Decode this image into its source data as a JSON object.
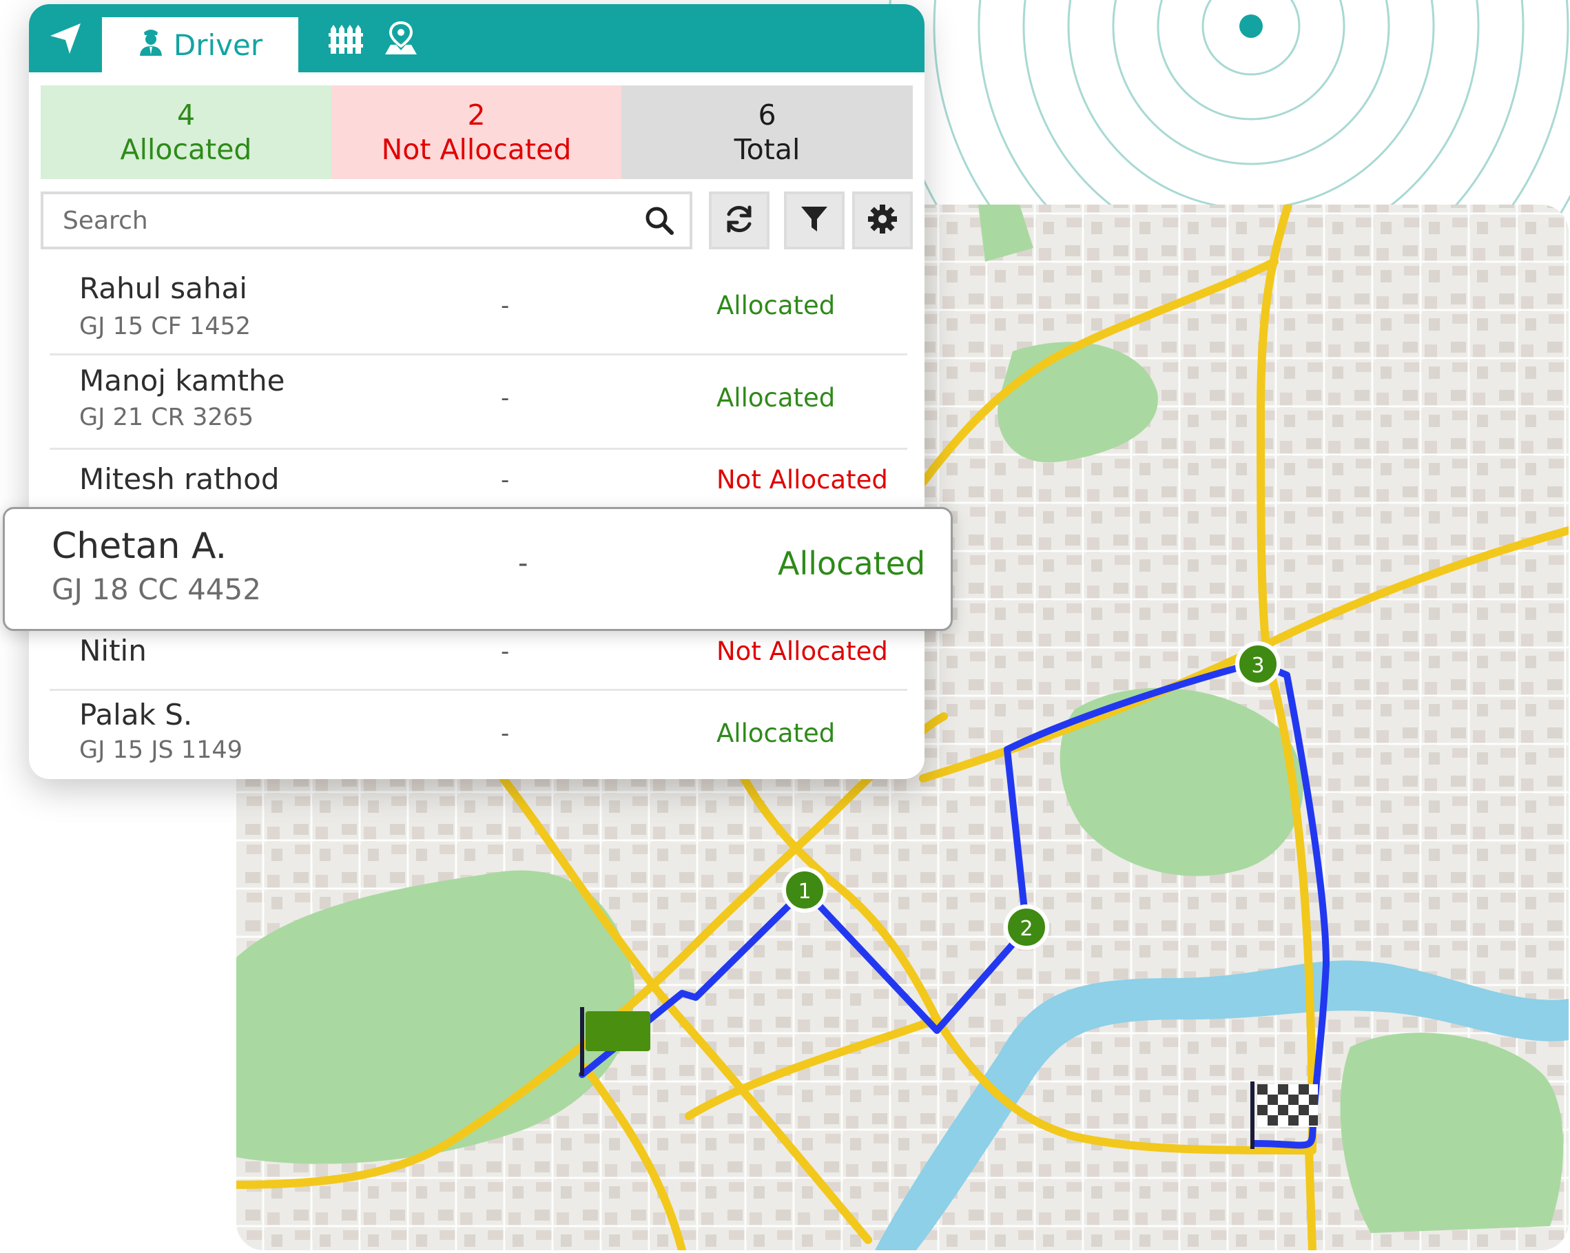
{
  "tabs": {
    "navigate_icon": "navigation-arrow-icon",
    "driver_label": "Driver",
    "driver_icon": "driver-icon",
    "geofence_icon": "fence-icon",
    "zone_icon": "map-pin-icon"
  },
  "summary": {
    "allocated_count": "4",
    "allocated_label": "Allocated",
    "not_allocated_count": "2",
    "not_allocated_label": "Not Allocated",
    "total_count": "6",
    "total_label": "Total"
  },
  "search": {
    "placeholder": "Search",
    "value": ""
  },
  "toolbar": {
    "refresh_icon": "refresh-icon",
    "filter_icon": "filter-icon",
    "settings_icon": "gear-icon"
  },
  "drivers": [
    {
      "name": "Rahul sahai",
      "plate": "GJ 15 CF 1452",
      "info": "-",
      "status": "Allocated"
    },
    {
      "name": "Manoj kamthe",
      "plate": "GJ 21 CR 3265",
      "info": "-",
      "status": "Allocated"
    },
    {
      "name": "Mitesh rathod",
      "plate": "",
      "info": "-",
      "status": "Not Allocated"
    },
    {
      "name": "Nitin",
      "plate": "",
      "info": "-",
      "status": "Not Allocated"
    },
    {
      "name": "Palak S.",
      "plate": "GJ 15 JS 1149",
      "info": "-",
      "status": "Allocated"
    }
  ],
  "highlighted_driver": {
    "name": "Chetan A.",
    "plate": "GJ 18 CC 4452",
    "info": "-",
    "status": "Allocated"
  },
  "map": {
    "waypoints": [
      "1",
      "2",
      "3"
    ],
    "start_icon": "start-flag-icon",
    "finish_icon": "checkered-finish-flag-icon"
  },
  "colors": {
    "brand": "#13a4a1",
    "allocated": "#2e8a19",
    "not_allocated": "#e00000",
    "route": "#2238f0",
    "road": "#f2c81c",
    "park": "#a9d9a0",
    "river": "#8dd0e8",
    "waypoint": "#3f8a12"
  }
}
